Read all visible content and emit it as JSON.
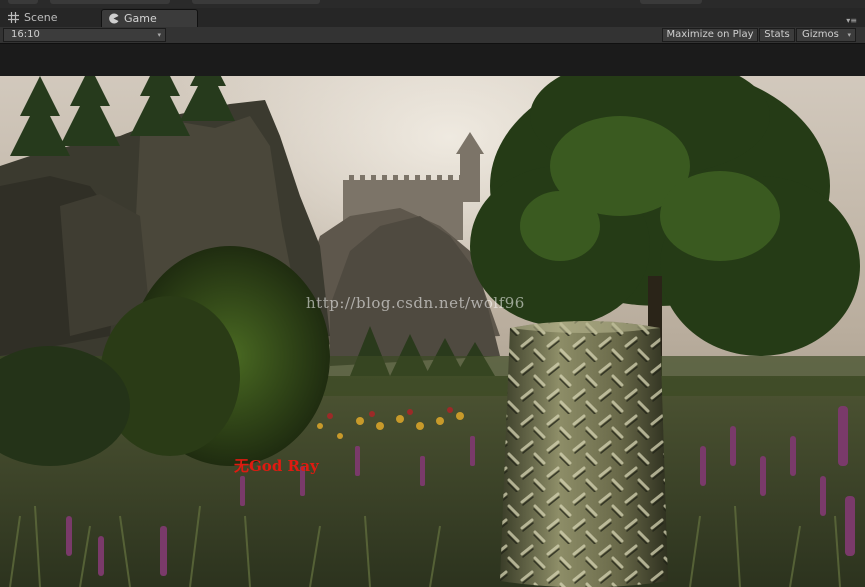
{
  "tabs": [
    {
      "label": "Scene",
      "icon": "grid-icon"
    },
    {
      "label": "Game",
      "icon": "pacman-icon",
      "active": true
    }
  ],
  "toolbar": {
    "aspect": "16:10",
    "maximize_on_play": "Maximize on Play",
    "stats": "Stats",
    "gizmos": "Gizmos"
  },
  "viewport": {
    "watermark": "http://blog.csdn.net/wolf96",
    "label": "无God Ray"
  },
  "colors": {
    "tab_bar": "#262626",
    "toolbar": "#333333",
    "label_red": "#e01a10"
  }
}
